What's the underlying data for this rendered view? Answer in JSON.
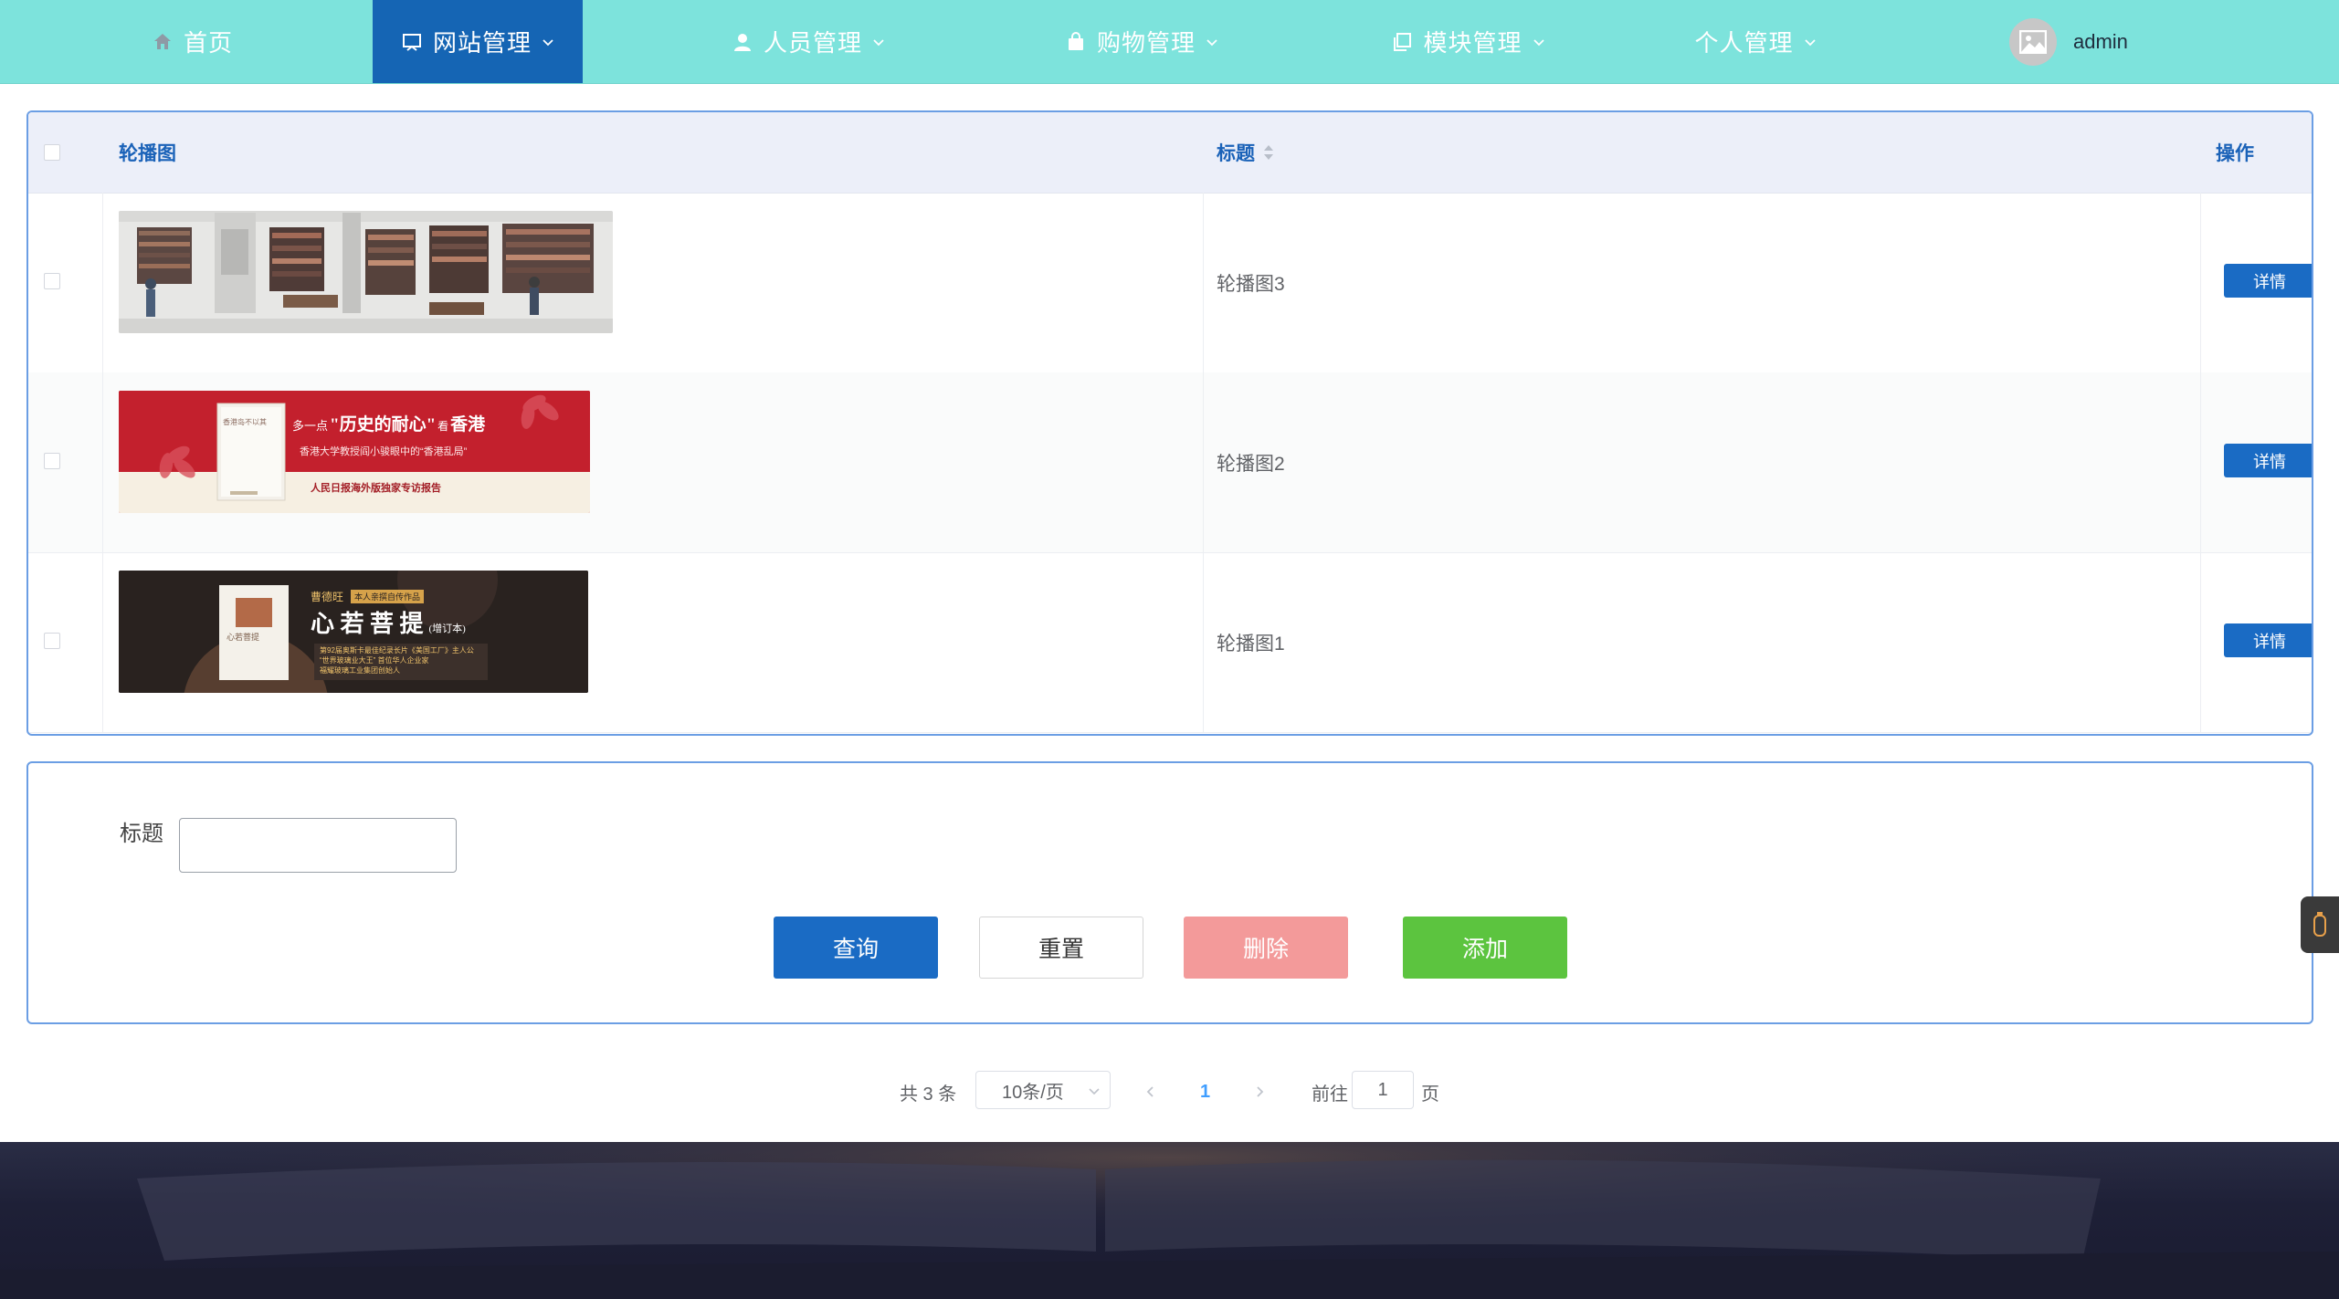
{
  "nav": {
    "items": [
      {
        "label": "首页",
        "icon": "home-icon"
      },
      {
        "label": "网站管理",
        "icon": "monitor-icon",
        "active": true
      },
      {
        "label": "人员管理",
        "icon": "person-icon"
      },
      {
        "label": "购物管理",
        "icon": "shopping-bag-icon"
      },
      {
        "label": "模块管理",
        "icon": "copy-icon"
      },
      {
        "label": "个人管理",
        "icon": ""
      }
    ],
    "user": "admin"
  },
  "table": {
    "headers": {
      "image": "轮播图",
      "title": "标题",
      "action": "操作"
    },
    "rows": [
      {
        "title": "轮播图3",
        "action": "详情"
      },
      {
        "title": "轮播图2",
        "action": "详情"
      },
      {
        "title": "轮播图1",
        "action": "详情"
      }
    ],
    "banners": {
      "b2": {
        "book_cover_title": "香港岛不以其",
        "headline_a": "多一点",
        "headline_b": "\"历史的耐心\"",
        "headline_c": "看",
        "headline_d": "香港",
        "subline": "香港大学教授阎小骏眼中的“香港乱局”",
        "footline": "人民日报海外版独家专访报告"
      },
      "b1": {
        "author": "曹德旺",
        "tag": "本人亲撰自传作品",
        "title": "心 若 菩 提",
        "edition": "(增订本)",
        "line1": "第92届奥斯卡最佳纪录长片《美国工厂》主人公",
        "line2": "“世界玻璃业大王” 首位华人企业家",
        "line3": "福耀玻璃工业集团创始人",
        "cover_title": "心若菩提"
      }
    }
  },
  "form": {
    "title_label": "标题",
    "title_value": "",
    "buttons": {
      "query": "查询",
      "reset": "重置",
      "delete": "删除",
      "add": "添加"
    }
  },
  "pagination": {
    "total": "共 3 条",
    "page_size": "10条/页",
    "current_page": "1",
    "goto_label": "前往",
    "goto_value": "1",
    "page_suffix": "页"
  },
  "colors": {
    "nav_bg": "#7de3dc",
    "nav_active": "#1565b4",
    "accent": "#1a6bc4",
    "delete": "#f39a9a",
    "add": "#5cc43f"
  }
}
